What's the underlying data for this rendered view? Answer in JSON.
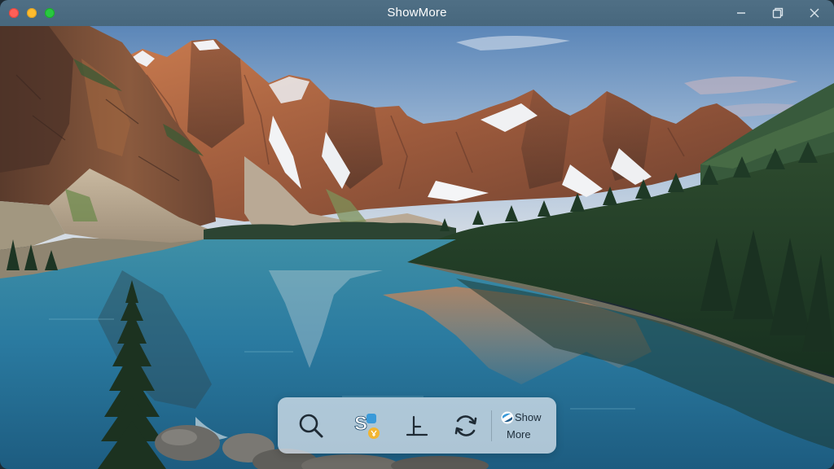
{
  "window": {
    "title": "ShowMore",
    "controls": {
      "close_color": "#fe5f57",
      "minimize_color": "#febc2e",
      "maximize_color": "#28c840"
    },
    "right_controls": [
      "minimize-icon",
      "restore-icon",
      "close-icon"
    ]
  },
  "scene": {
    "subject": "mountain-lake-landscape"
  },
  "toolbar": {
    "tools": [
      {
        "name": "search",
        "icon": "magnifier-icon"
      },
      {
        "name": "translate",
        "icon": "translate-icon"
      },
      {
        "name": "pin",
        "icon": "pin-icon"
      },
      {
        "name": "refresh",
        "icon": "refresh-icon"
      }
    ],
    "brand": {
      "line1": "Show",
      "line2": "More",
      "icon": "showmore-logo-icon"
    },
    "accent": "#3a9ad9"
  }
}
